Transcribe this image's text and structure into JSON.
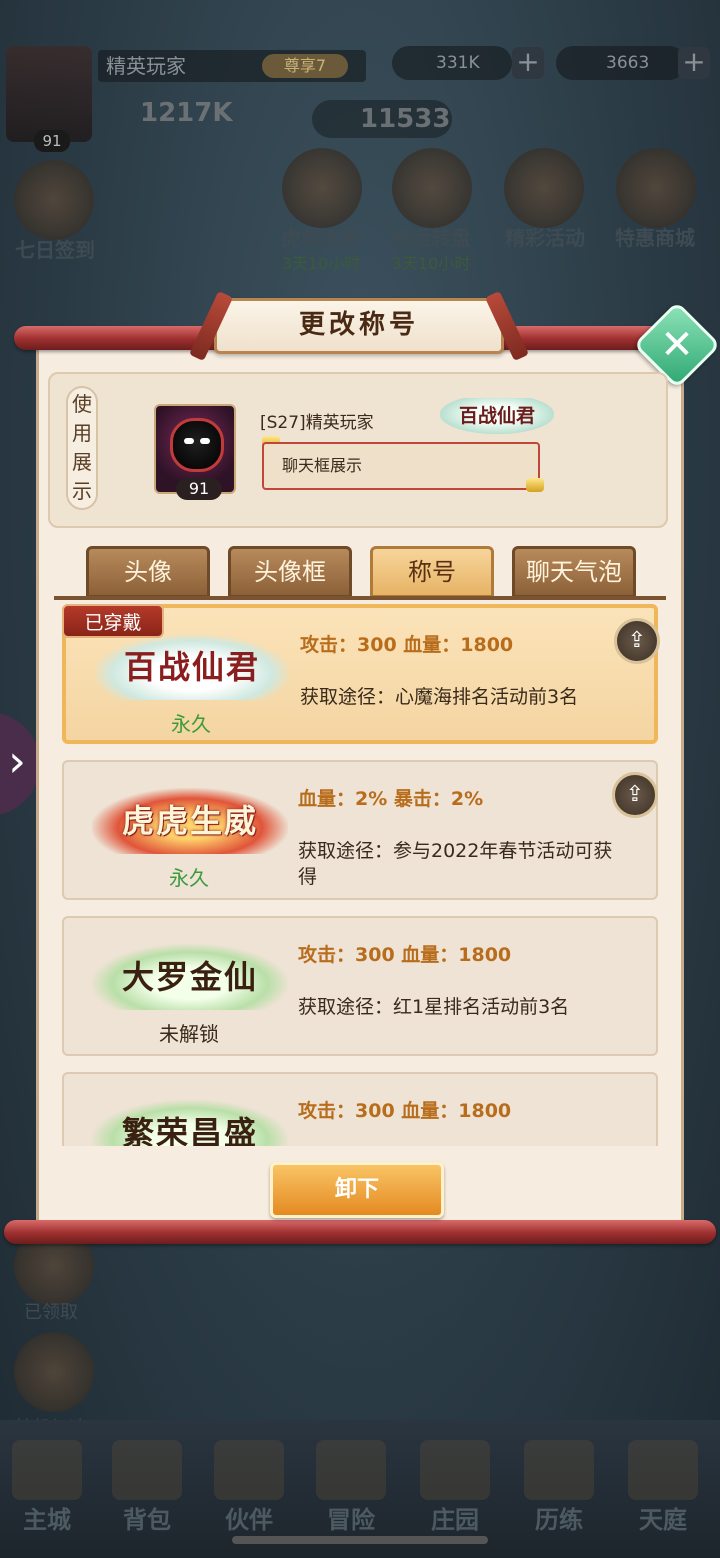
{
  "background": {
    "player_name": "精英玩家",
    "vip": "尊享7",
    "level": "91",
    "power": "1217K",
    "gold": "331K",
    "gems": "3663",
    "currency2": "11533",
    "events": [
      {
        "label": "七日签到",
        "sub": ""
      },
      {
        "label": "虎年大吉",
        "sub": "3天10小时"
      },
      {
        "label": "幸运转盘",
        "sub": "3天10小时"
      },
      {
        "label": "精彩活动",
        "sub": ""
      },
      {
        "label": "特惠商城",
        "sub": ""
      }
    ],
    "side_labels": [
      "已领取",
      "挂机加速"
    ],
    "nav": [
      "主城",
      "背包",
      "伙伴",
      "冒险",
      "庄园",
      "历练",
      "天庭"
    ]
  },
  "dialog": {
    "title": "更改称号",
    "use_label": "使用展示",
    "preview": {
      "level": "91",
      "name": "[S27]精英玩家",
      "badge": "百战仙君",
      "chat_frame_text": "聊天框展示"
    },
    "tabs": [
      {
        "label": "头像",
        "active": false
      },
      {
        "label": "头像框",
        "active": false
      },
      {
        "label": "称号",
        "active": true
      },
      {
        "label": "聊天气泡",
        "active": false
      }
    ],
    "worn_tag": "已穿戴",
    "titles": [
      {
        "name": "百战仙君",
        "status": "永久",
        "stats": "攻击：300  血量：1800",
        "source": "获取途径：心魔海排名活动前3名"
      },
      {
        "name": "虎虎生威",
        "status": "永久",
        "stats": "血量：2%  暴击：2%",
        "source": "获取途径：参与2022年春节活动可获得"
      },
      {
        "name": "大罗金仙",
        "status": "未解锁",
        "stats": "攻击：300  血量：1800",
        "source": "获取途径：红1星排名活动前3名"
      },
      {
        "name": "繁荣昌盛",
        "status": "",
        "stats": "攻击：300  血量：1800",
        "source": ""
      }
    ],
    "unequip_label": "卸下"
  },
  "colors": {
    "accent_orange": "#e48a22",
    "card_selected_border": "#f0b65a",
    "status_green": "#3c9a3c",
    "stats_text": "#b86d1c",
    "close_green": "#2fa873"
  },
  "icons": [
    "share-icon",
    "close-icon",
    "chevron-right-icon",
    "gold-coin-icon",
    "gem-icon",
    "plus-icon"
  ]
}
